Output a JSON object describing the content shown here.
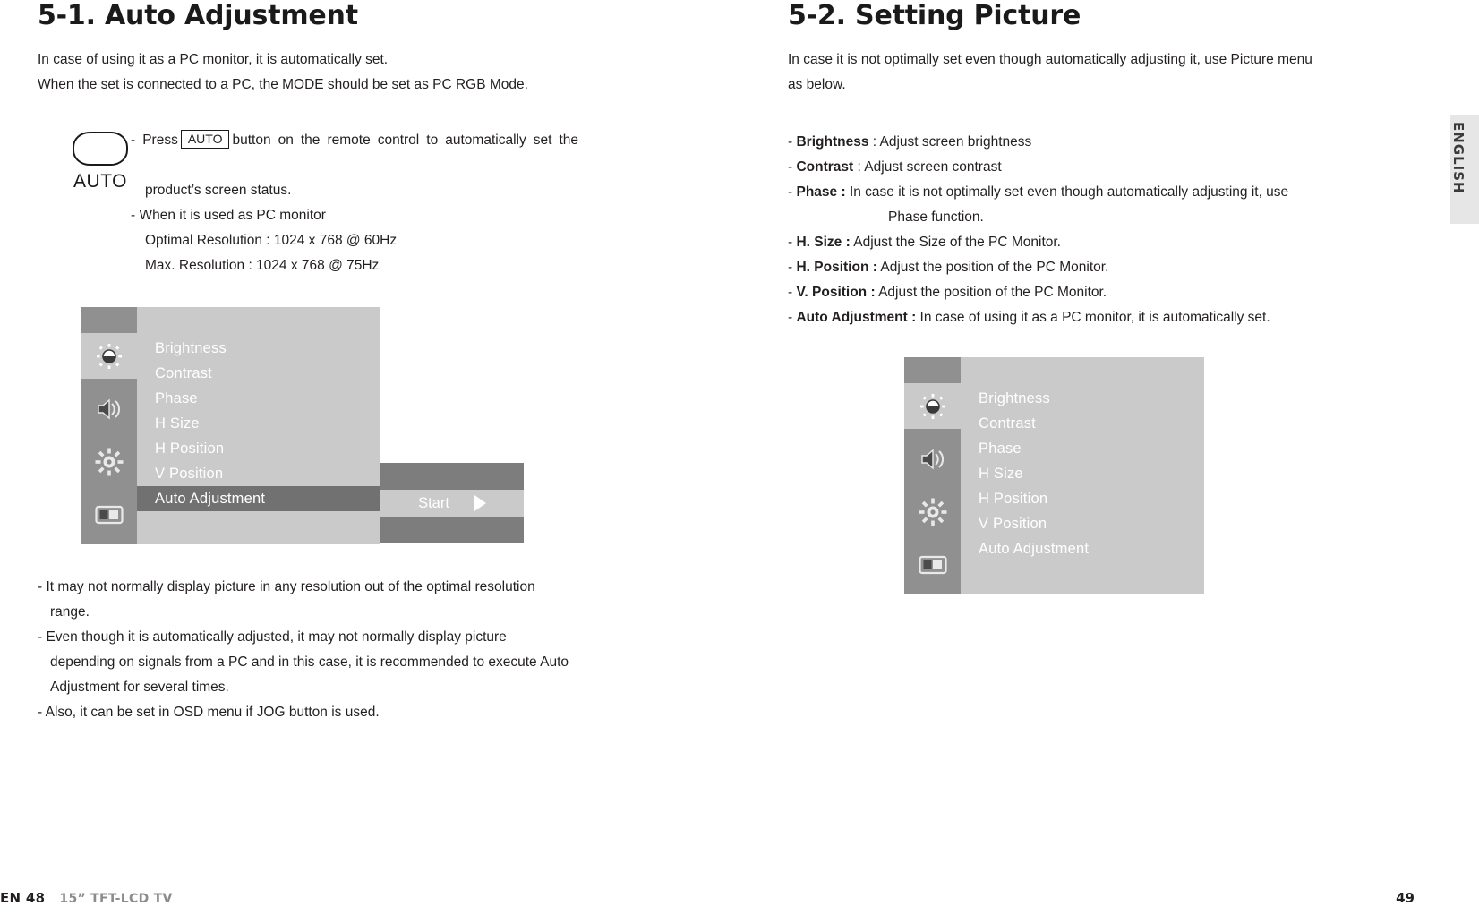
{
  "left": {
    "title": "5-1. Auto Adjustment",
    "intro": [
      "In case of using it as a PC monitor, it is automatically set.",
      "When the set is connected to a PC, the MODE should be set as PC RGB Mode."
    ],
    "auto_key": {
      "label": "AUTO",
      "inline_key_label": "AUTO"
    },
    "auto_text": {
      "press_before": "- Press",
      "press_after": "button on the remote control to automatically set the",
      "press_line2": "product’s screen status.",
      "when_used": "- When it is used as PC monitor",
      "optimal": "Optimal Resolution : 1024 x 768 @ 60Hz",
      "max": "Max. Resolution : 1024 x 768 @ 75Hz"
    },
    "osd": {
      "items": [
        {
          "label": "Brightness",
          "selected": false
        },
        {
          "label": "Contrast",
          "selected": false
        },
        {
          "label": "Phase",
          "selected": false
        },
        {
          "label": "H Size",
          "selected": false
        },
        {
          "label": "H Position",
          "selected": false
        },
        {
          "label": "V Position",
          "selected": false
        },
        {
          "label": "Auto Adjustment",
          "selected": true
        }
      ],
      "icons": [
        "brightness-icon",
        "speaker-icon",
        "gear-icon",
        "screen-icon"
      ],
      "active_icon_index": 0,
      "value_label": "Start",
      "value_arrow": "right-triangle-icon"
    },
    "notes": [
      "- It may not normally display picture in any resolution out of the optimal resolution range.",
      "- Even though it is automatically adjusted, it may not normally display picture depending on signals from a PC and in this case, it is recommended to execute Auto Adjustment for several times.",
      "- Also, it can be set in OSD menu if JOG button is used."
    ],
    "notes_split": [
      {
        "line1": "- It may not normally display picture in any resolution out of the optimal resolution",
        "line2": "range."
      },
      {
        "line1": "- Even though it is automatically adjusted, it may not normally display picture",
        "line2": "depending on signals from a PC and in this case, it is recommended to execute Auto",
        "line3": "Adjustment for several times."
      },
      {
        "line1": "- Also, it can be set in OSD menu if JOG button is used."
      }
    ]
  },
  "right": {
    "title": "5-2. Setting Picture",
    "intro": [
      "In case it is not optimally set even though automatically adjusting it, use Picture menu",
      "as below."
    ],
    "definitions": [
      {
        "dash": "-",
        "term": "Brightness",
        "sep": " : ",
        "desc": "Adjust screen brightness",
        "cont": ""
      },
      {
        "dash": "-",
        "term": "Contrast",
        "sep": " : ",
        "desc": "Adjust screen contrast",
        "cont": ""
      },
      {
        "dash": "-",
        "term": "Phase :",
        "sep": " ",
        "desc": "In case it is not optimally set even though automatically adjusting it, use",
        "cont": "Phase function."
      },
      {
        "dash": "-",
        "term": "H. Size :",
        "sep": " ",
        "desc": "Adjust the Size of the PC Monitor.",
        "cont": ""
      },
      {
        "dash": "-",
        "term": "H. Position :",
        "sep": " ",
        "desc": "Adjust the position of the PC Monitor.",
        "cont": ""
      },
      {
        "dash": "-",
        "term": "V. Position :",
        "sep": "  ",
        "desc": "Adjust the position of the PC Monitor.",
        "cont": ""
      },
      {
        "dash": "-",
        "term": "Auto Adjustment :",
        "sep": " ",
        "desc": "In case of using it as a PC monitor, it is automatically set.",
        "cont": ""
      }
    ],
    "osd": {
      "items": [
        {
          "label": "Brightness",
          "selected": false
        },
        {
          "label": "Contrast",
          "selected": false
        },
        {
          "label": "Phase",
          "selected": false
        },
        {
          "label": "H Size",
          "selected": false
        },
        {
          "label": "H Position",
          "selected": false
        },
        {
          "label": "V Position",
          "selected": false
        },
        {
          "label": "Auto Adjustment",
          "selected": false
        }
      ],
      "icons": [
        "brightness-icon",
        "speaker-icon",
        "gear-icon",
        "screen-icon"
      ],
      "active_icon_index": 0
    }
  },
  "lang_tab": {
    "label": "ENGLISH"
  },
  "footer": {
    "en_page": "EN 48",
    "model": "15” TFT-LCD TV",
    "page_number": "49"
  },
  "colors": {
    "osd_panel": "#cacaca",
    "osd_iconbar": "#909090",
    "osd_selected": "#717171",
    "osd_value_band": "#7d7d7d",
    "lang_tab_bg": "#e6e6e6",
    "text": "#231f20",
    "model_gray": "#8c8c8c"
  }
}
